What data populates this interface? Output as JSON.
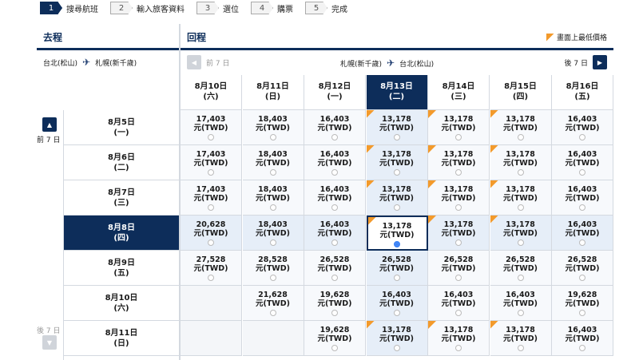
{
  "steps": [
    {
      "num": "1",
      "label": "搜尋航班",
      "active": true
    },
    {
      "num": "2",
      "label": "輸入旅客資料",
      "active": false
    },
    {
      "num": "3",
      "label": "選位",
      "active": false
    },
    {
      "num": "4",
      "label": "購票",
      "active": false
    },
    {
      "num": "5",
      "label": "完成",
      "active": false
    }
  ],
  "outbound": {
    "title": "去程",
    "from": "台北(松山)",
    "to": "札幌(新千歲)"
  },
  "inbound": {
    "title": "回程",
    "from": "札幌(新千歲)",
    "to": "台北(松山)",
    "prev_label": "前 7 日",
    "next_label": "後 7 日"
  },
  "legend": "畫面上最低價格",
  "side": {
    "prev_label": "前 7 日",
    "next_label": "後 7 日"
  },
  "return_dates": [
    {
      "date": "8月10日",
      "day": "(六)"
    },
    {
      "date": "8月11日",
      "day": "(日)"
    },
    {
      "date": "8月12日",
      "day": "(一)"
    },
    {
      "date": "8月13日",
      "day": "(二)"
    },
    {
      "date": "8月14日",
      "day": "(三)"
    },
    {
      "date": "8月15日",
      "day": "(四)"
    },
    {
      "date": "8月16日",
      "day": "(五)"
    }
  ],
  "selected_return_index": 3,
  "depart_dates": [
    {
      "date": "8月5日",
      "day": "(一)"
    },
    {
      "date": "8月6日",
      "day": "(二)"
    },
    {
      "date": "8月7日",
      "day": "(三)"
    },
    {
      "date": "8月8日",
      "day": "(四)"
    },
    {
      "date": "8月9日",
      "day": "(五)"
    },
    {
      "date": "8月10日",
      "day": "(六)"
    },
    {
      "date": "8月11日",
      "day": "(日)"
    }
  ],
  "selected_depart_index": 3,
  "currency": "元(TWD)",
  "prices": [
    [
      "17,403",
      "18,403",
      "16,403",
      "13,178",
      "13,178",
      "13,178",
      "16,403"
    ],
    [
      "17,403",
      "18,403",
      "16,403",
      "13,178",
      "13,178",
      "13,178",
      "16,403"
    ],
    [
      "17,403",
      "18,403",
      "16,403",
      "13,178",
      "13,178",
      "13,178",
      "16,403"
    ],
    [
      "20,628",
      "18,403",
      "16,403",
      "13,178",
      "13,178",
      "13,178",
      "16,403"
    ],
    [
      "27,528",
      "28,528",
      "26,528",
      "26,528",
      "26,528",
      "26,528",
      "26,528"
    ],
    [
      "",
      "21,628",
      "19,628",
      "16,403",
      "16,403",
      "16,403",
      "19,628"
    ],
    [
      "",
      "",
      "19,628",
      "13,178",
      "13,178",
      "13,178",
      "16,403"
    ]
  ],
  "lowest": [
    [
      false,
      false,
      false,
      true,
      true,
      true,
      false
    ],
    [
      false,
      false,
      false,
      true,
      true,
      true,
      false
    ],
    [
      false,
      false,
      false,
      true,
      true,
      true,
      false
    ],
    [
      false,
      false,
      false,
      true,
      true,
      true,
      false
    ],
    [
      false,
      false,
      false,
      false,
      false,
      false,
      false
    ],
    [
      false,
      false,
      false,
      false,
      false,
      false,
      false
    ],
    [
      false,
      false,
      false,
      true,
      true,
      true,
      false
    ]
  ],
  "colors": {
    "navy": "#0d2d5a",
    "lowest_flag": "#f39a2b",
    "radio_selected": "#3b82f6"
  }
}
